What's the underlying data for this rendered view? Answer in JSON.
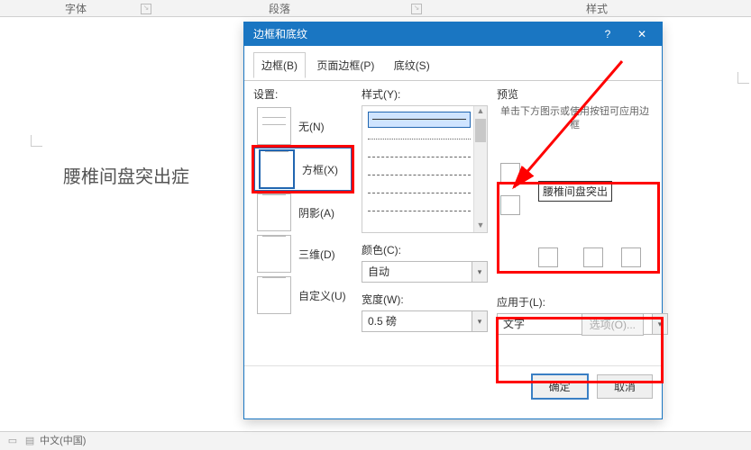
{
  "ribbon": {
    "font": "字体",
    "paragraph": "段落",
    "styles": "样式"
  },
  "document": {
    "text": "腰椎间盘突出症"
  },
  "dialog": {
    "title": "边框和底纹",
    "help": "?",
    "close": "✕",
    "tabs": {
      "borders": "边框(B)",
      "pageborder": "页面边框(P)",
      "shading": "底纹(S)"
    },
    "setting": {
      "label": "设置:",
      "none": "无(N)",
      "box": "方框(X)",
      "shadow": "阴影(A)",
      "threeD": "三维(D)",
      "custom": "自定义(U)"
    },
    "style": {
      "label": "样式(Y):",
      "color": "颜色(C):",
      "color_val": "自动",
      "width": "宽度(W):",
      "width_val": "0.5 磅"
    },
    "preview": {
      "label": "预览",
      "hint": "单击下方图示或使用按钮可应用边框",
      "text": "腰椎间盘突出"
    },
    "apply": {
      "label": "应用于(L):",
      "value": "文字",
      "options": "选项(O)..."
    },
    "ok": "确定",
    "cancel": "取消"
  },
  "status": {
    "lang": "中文(中国)"
  }
}
